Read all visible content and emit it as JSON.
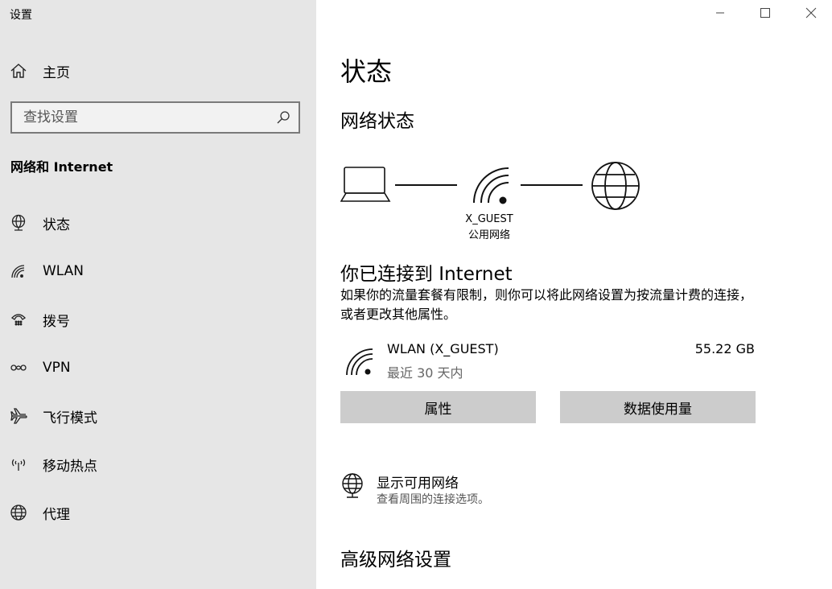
{
  "app": {
    "title": "设置"
  },
  "sidebar": {
    "home_label": "主页",
    "search_placeholder": "查找设置",
    "section_title": "网络和 Internet",
    "items": [
      {
        "label": "状态",
        "icon": "status-icon"
      },
      {
        "label": "WLAN",
        "icon": "wifi-icon"
      },
      {
        "label": "拨号",
        "icon": "dialup-icon"
      },
      {
        "label": "VPN",
        "icon": "vpn-icon"
      },
      {
        "label": "飞行模式",
        "icon": "airplane-icon"
      },
      {
        "label": "移动热点",
        "icon": "hotspot-icon"
      },
      {
        "label": "代理",
        "icon": "globe-icon"
      }
    ]
  },
  "main": {
    "title": "状态",
    "network_status_heading": "网络状态",
    "network_name": "X_GUEST",
    "network_type": "公用网络",
    "connected_heading": "你已连接到 Internet",
    "description": "如果你的流量套餐有限制，则你可以将此网络设置为按流量计费的连接，或者更改其他属性。",
    "connection": {
      "name": "WLAN (X_GUEST)",
      "period": "最近 30 天内",
      "usage": "55.22 GB"
    },
    "buttons": {
      "properties": "属性",
      "data_usage": "数据使用量"
    },
    "available": {
      "title": "显示可用网络",
      "subtitle": "查看周围的连接选项。"
    },
    "advanced_heading": "高级网络设置"
  }
}
